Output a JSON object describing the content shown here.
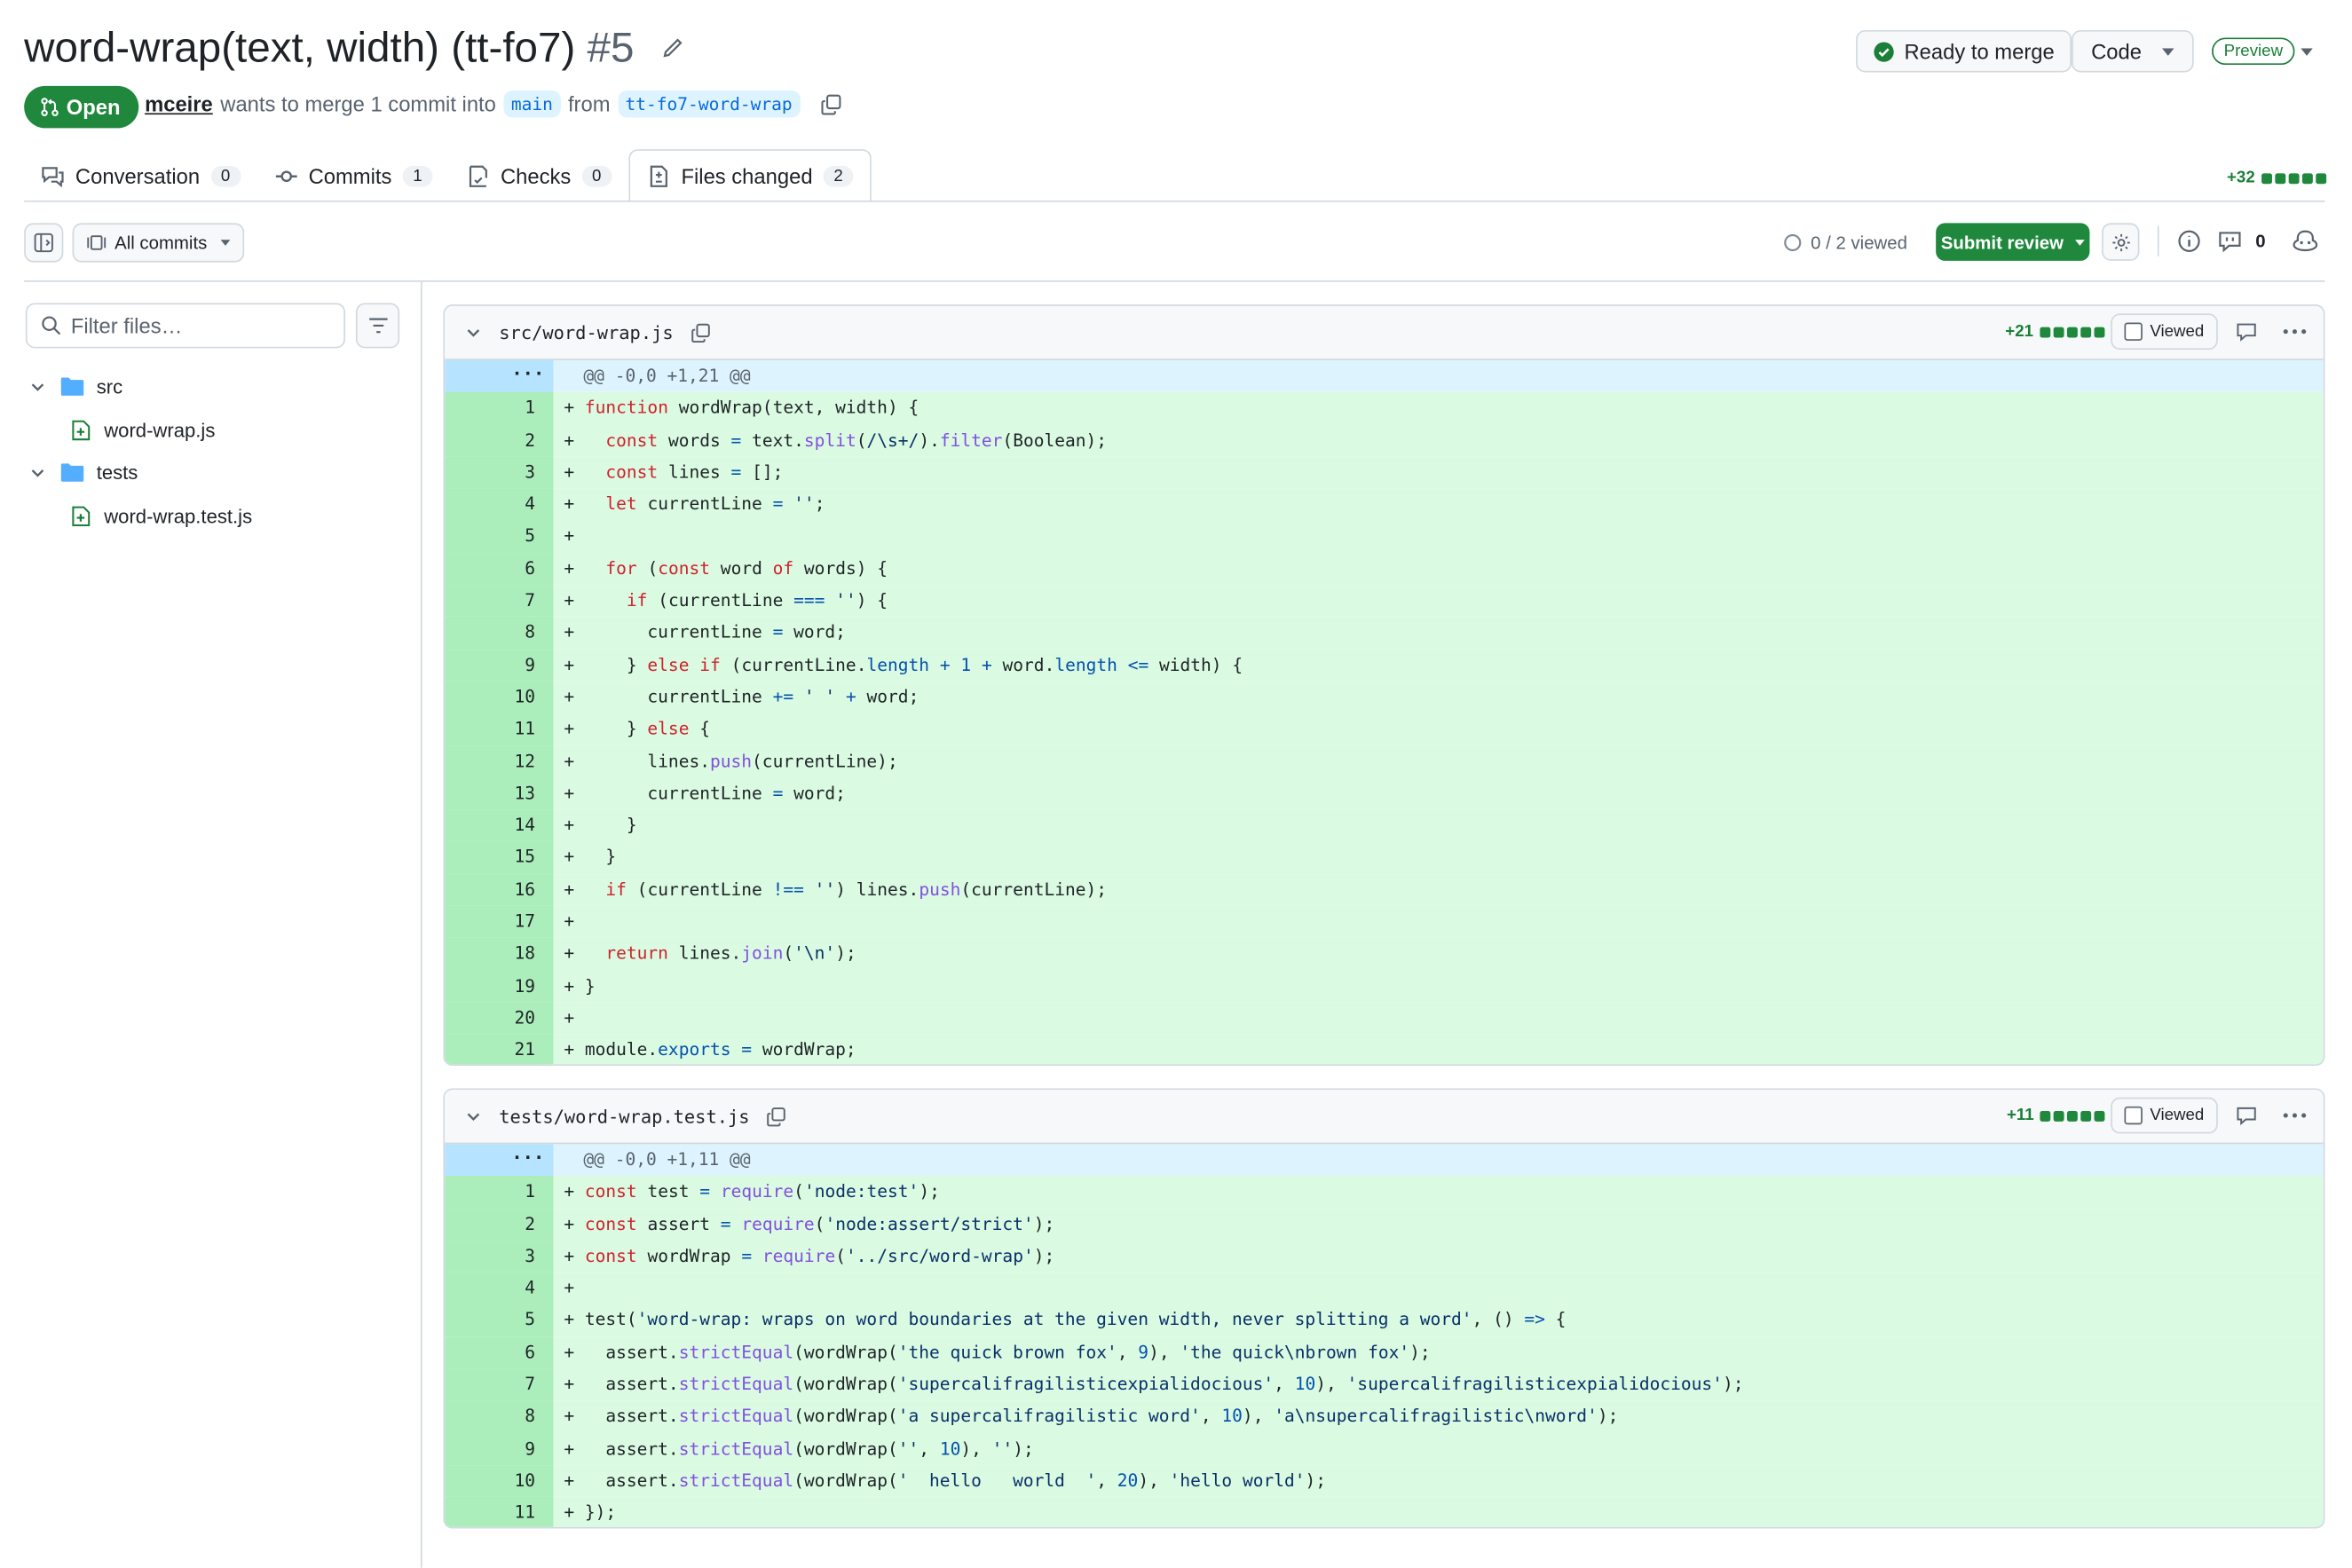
{
  "pr": {
    "title": "word-wrap(text, width) (tt-fo7)",
    "number": "#5",
    "state": "Open",
    "author": "mceire",
    "meta_text": "wants to merge 1 commit into",
    "base_branch": "main",
    "from_text": "from",
    "head_branch": "tt-fo7-word-wrap"
  },
  "header_actions": {
    "merge_status": "Ready to merge",
    "code_label": "Code",
    "preview_label": "Preview"
  },
  "tabs": [
    {
      "label": "Conversation",
      "count": "0",
      "icon": "conversation-icon"
    },
    {
      "label": "Commits",
      "count": "1",
      "icon": "commit-icon"
    },
    {
      "label": "Checks",
      "count": "0",
      "icon": "checklist-icon"
    },
    {
      "label": "Files changed",
      "count": "2",
      "icon": "file-diff-icon",
      "active": true
    }
  ],
  "diffstat": {
    "total": "+32",
    "blocks_added": 5
  },
  "toolbar": {
    "commits_filter": "All commits",
    "viewed_progress": "0 / 2 viewed",
    "submit_review": "Submit review",
    "comments_count": "0"
  },
  "file_tree": {
    "filter_placeholder": "Filter files…",
    "items": [
      {
        "type": "folder",
        "name": "src",
        "level": 0
      },
      {
        "type": "file",
        "name": "word-wrap.js",
        "level": 1
      },
      {
        "type": "folder",
        "name": "tests",
        "level": 0
      },
      {
        "type": "file",
        "name": "word-wrap.test.js",
        "level": 1
      }
    ]
  },
  "files": [
    {
      "path": "src/word-wrap.js",
      "additions": "+21",
      "viewed_label": "Viewed",
      "hunk_header": "@@ -0,0 +1,21 @@",
      "lines": [
        "function wordWrap(text, width) {",
        "  const words = text.split(/\\s+/).filter(Boolean);",
        "  const lines = [];",
        "  let currentLine = '';",
        "",
        "  for (const word of words) {",
        "    if (currentLine === '') {",
        "      currentLine = word;",
        "    } else if (currentLine.length + 1 + word.length <= width) {",
        "      currentLine += ' ' + word;",
        "    } else {",
        "      lines.push(currentLine);",
        "      currentLine = word;",
        "    }",
        "  }",
        "  if (currentLine !== '') lines.push(currentLine);",
        "",
        "  return lines.join('\\n');",
        "}",
        "",
        "module.exports = wordWrap;"
      ]
    },
    {
      "path": "tests/word-wrap.test.js",
      "additions": "+11",
      "viewed_label": "Viewed",
      "hunk_header": "@@ -0,0 +1,11 @@",
      "lines": [
        "const test = require('node:test');",
        "const assert = require('node:assert/strict');",
        "const wordWrap = require('../src/word-wrap');",
        "",
        "test('word-wrap: wraps on word boundaries at the given width, never splitting a word', () => {",
        "  assert.strictEqual(wordWrap('the quick brown fox', 9), 'the quick\\nbrown fox');",
        "  assert.strictEqual(wordWrap('supercalifragilisticexpialidocious', 10), 'supercalifragilisticexpialidocious');",
        "  assert.strictEqual(wordWrap('a supercalifragilistic word', 10), 'a\\nsupercalifragilistic\\nword');",
        "  assert.strictEqual(wordWrap('', 10), '');",
        "  assert.strictEqual(wordWrap('  hello   world  ', 20), 'hello world');",
        "});"
      ]
    }
  ],
  "colors": {
    "open_green": "#1f883d",
    "added_line_bg": "#dafbe1",
    "added_gutter_bg": "#aceebb",
    "hunk_bg": "#ddf4ff",
    "link_blue": "#0969da"
  }
}
